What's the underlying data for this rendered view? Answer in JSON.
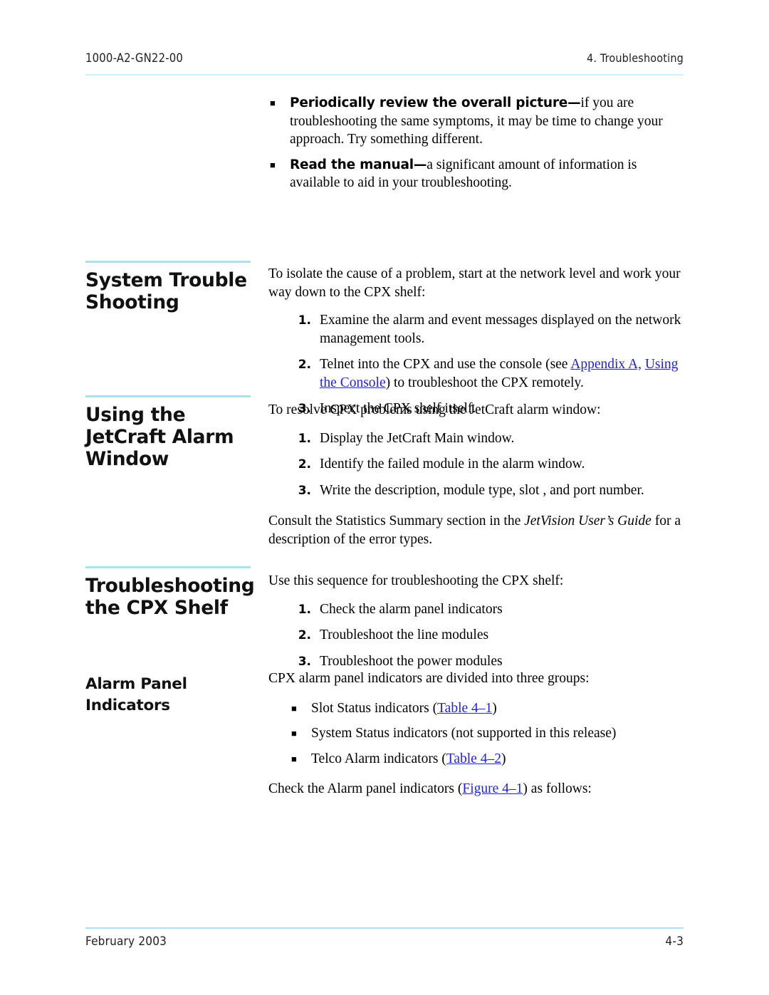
{
  "header": {
    "doc_number": "1000-A2-GN22-00",
    "chapter": "4. Troubleshooting"
  },
  "footer": {
    "date": "February 2003",
    "page_number": "4-3"
  },
  "colors": {
    "rule": "#a9e2ee",
    "xref_link": "#2222dd",
    "heading": "#111111"
  },
  "intro_bullets": [
    {
      "marker": "■",
      "lead": "Periodically review the overall picture",
      "dash": "—",
      "text": "if you are troubleshooting the same symptoms, it may be time to change your approach. Try something different."
    },
    {
      "marker": "■",
      "lead": "Read the manual",
      "dash": "—",
      "text": "a significant amount of information is available to aid in your troubleshooting."
    }
  ],
  "sections": [
    {
      "heading": "System Trouble Shooting",
      "heading_lines": [
        "System Trouble",
        "Shooting"
      ],
      "has_rule": true,
      "intro": "To isolate the cause of a problem, start at the network level and work your way down to the CPX shelf:",
      "steps": [
        {
          "number": "1.",
          "text": "Examine the alarm and event messages displayed on the network management tools."
        },
        {
          "number": "2.",
          "pre": "Telnet into the CPX and use the console (see ",
          "xref1": "Appendix A,",
          "mid": " ",
          "xref2": "Using the Console",
          "post": ") to troubleshoot the CPX remotely."
        },
        {
          "number": "3.",
          "text": "Inspect the CPX shelf itself."
        }
      ]
    },
    {
      "heading": "Using the JetCraft Alarm Window",
      "heading_lines": [
        "Using the",
        "JetCraft Alarm",
        "Window"
      ],
      "has_rule": true,
      "intro": "To resolve CPX problems using the JetCraft alarm window:",
      "steps": [
        {
          "number": "1.",
          "text": "Display the JetCraft Main window."
        },
        {
          "number": "2.",
          "text": "Identify the failed module in the alarm window."
        },
        {
          "number": "3.",
          "text": "Write the description, module type, slot , and port number."
        }
      ],
      "closing_pre": "Consult the Statistics Summary section in the ",
      "closing_italic": "JetVision User’s Guide",
      "closing_post": " for a description of the error types."
    },
    {
      "heading": "Troubleshooting the CPX Shelf",
      "heading_lines": [
        "Troubleshooting",
        "the CPX Shelf"
      ],
      "has_rule": true,
      "intro": "Use this sequence for troubleshooting the CPX shelf:",
      "steps": [
        {
          "number": "1.",
          "text": "Check the alarm panel indicators"
        },
        {
          "number": "2.",
          "text": "Troubleshoot the line modules"
        },
        {
          "number": "3.",
          "text": "Troubleshoot the power modules"
        }
      ]
    },
    {
      "heading": "Alarm Panel Indicators",
      "heading_lines": [
        "Alarm Panel",
        "Indicators"
      ],
      "has_rule": false,
      "intro": "CPX alarm panel indicators are divided into three groups:",
      "bullets": [
        {
          "marker": "■",
          "pre": "Slot Status indicators (",
          "xref": "Table 4–1",
          "post": ")"
        },
        {
          "marker": "■",
          "pre": "System Status indicators (not supported in this release)",
          "xref": "",
          "post": ""
        },
        {
          "marker": "■",
          "pre": "Telco Alarm indicators (",
          "xref": "Table 4–2",
          "post": ")"
        }
      ],
      "closing_pre": "Check the Alarm panel indicators (",
      "closing_xref": "Figure 4–1",
      "closing_post": ") as follows:"
    }
  ]
}
